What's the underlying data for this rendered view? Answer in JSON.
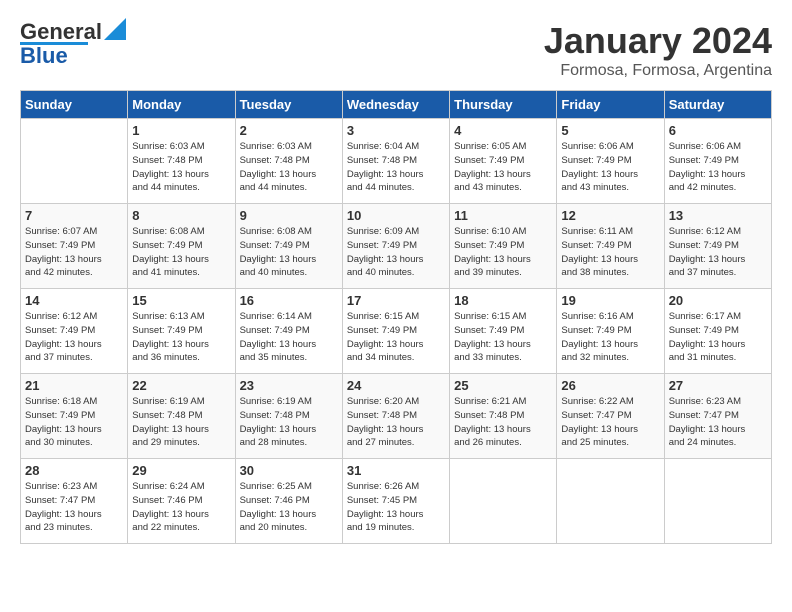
{
  "logo": {
    "general": "General",
    "blue": "Blue"
  },
  "header": {
    "month_year": "January 2024",
    "location": "Formosa, Formosa, Argentina"
  },
  "days_of_week": [
    "Sunday",
    "Monday",
    "Tuesday",
    "Wednesday",
    "Thursday",
    "Friday",
    "Saturday"
  ],
  "weeks": [
    [
      {
        "day": "",
        "sunrise": "",
        "sunset": "",
        "daylight": ""
      },
      {
        "day": "1",
        "sunrise": "6:03 AM",
        "sunset": "7:48 PM",
        "daylight": "13 hours and 44 minutes."
      },
      {
        "day": "2",
        "sunrise": "6:03 AM",
        "sunset": "7:48 PM",
        "daylight": "13 hours and 44 minutes."
      },
      {
        "day": "3",
        "sunrise": "6:04 AM",
        "sunset": "7:48 PM",
        "daylight": "13 hours and 44 minutes."
      },
      {
        "day": "4",
        "sunrise": "6:05 AM",
        "sunset": "7:49 PM",
        "daylight": "13 hours and 43 minutes."
      },
      {
        "day": "5",
        "sunrise": "6:06 AM",
        "sunset": "7:49 PM",
        "daylight": "13 hours and 43 minutes."
      },
      {
        "day": "6",
        "sunrise": "6:06 AM",
        "sunset": "7:49 PM",
        "daylight": "13 hours and 42 minutes."
      }
    ],
    [
      {
        "day": "7",
        "sunrise": "6:07 AM",
        "sunset": "7:49 PM",
        "daylight": "13 hours and 42 minutes."
      },
      {
        "day": "8",
        "sunrise": "6:08 AM",
        "sunset": "7:49 PM",
        "daylight": "13 hours and 41 minutes."
      },
      {
        "day": "9",
        "sunrise": "6:08 AM",
        "sunset": "7:49 PM",
        "daylight": "13 hours and 40 minutes."
      },
      {
        "day": "10",
        "sunrise": "6:09 AM",
        "sunset": "7:49 PM",
        "daylight": "13 hours and 40 minutes."
      },
      {
        "day": "11",
        "sunrise": "6:10 AM",
        "sunset": "7:49 PM",
        "daylight": "13 hours and 39 minutes."
      },
      {
        "day": "12",
        "sunrise": "6:11 AM",
        "sunset": "7:49 PM",
        "daylight": "13 hours and 38 minutes."
      },
      {
        "day": "13",
        "sunrise": "6:12 AM",
        "sunset": "7:49 PM",
        "daylight": "13 hours and 37 minutes."
      }
    ],
    [
      {
        "day": "14",
        "sunrise": "6:12 AM",
        "sunset": "7:49 PM",
        "daylight": "13 hours and 37 minutes."
      },
      {
        "day": "15",
        "sunrise": "6:13 AM",
        "sunset": "7:49 PM",
        "daylight": "13 hours and 36 minutes."
      },
      {
        "day": "16",
        "sunrise": "6:14 AM",
        "sunset": "7:49 PM",
        "daylight": "13 hours and 35 minutes."
      },
      {
        "day": "17",
        "sunrise": "6:15 AM",
        "sunset": "7:49 PM",
        "daylight": "13 hours and 34 minutes."
      },
      {
        "day": "18",
        "sunrise": "6:15 AM",
        "sunset": "7:49 PM",
        "daylight": "13 hours and 33 minutes."
      },
      {
        "day": "19",
        "sunrise": "6:16 AM",
        "sunset": "7:49 PM",
        "daylight": "13 hours and 32 minutes."
      },
      {
        "day": "20",
        "sunrise": "6:17 AM",
        "sunset": "7:49 PM",
        "daylight": "13 hours and 31 minutes."
      }
    ],
    [
      {
        "day": "21",
        "sunrise": "6:18 AM",
        "sunset": "7:49 PM",
        "daylight": "13 hours and 30 minutes."
      },
      {
        "day": "22",
        "sunrise": "6:19 AM",
        "sunset": "7:48 PM",
        "daylight": "13 hours and 29 minutes."
      },
      {
        "day": "23",
        "sunrise": "6:19 AM",
        "sunset": "7:48 PM",
        "daylight": "13 hours and 28 minutes."
      },
      {
        "day": "24",
        "sunrise": "6:20 AM",
        "sunset": "7:48 PM",
        "daylight": "13 hours and 27 minutes."
      },
      {
        "day": "25",
        "sunrise": "6:21 AM",
        "sunset": "7:48 PM",
        "daylight": "13 hours and 26 minutes."
      },
      {
        "day": "26",
        "sunrise": "6:22 AM",
        "sunset": "7:47 PM",
        "daylight": "13 hours and 25 minutes."
      },
      {
        "day": "27",
        "sunrise": "6:23 AM",
        "sunset": "7:47 PM",
        "daylight": "13 hours and 24 minutes."
      }
    ],
    [
      {
        "day": "28",
        "sunrise": "6:23 AM",
        "sunset": "7:47 PM",
        "daylight": "13 hours and 23 minutes."
      },
      {
        "day": "29",
        "sunrise": "6:24 AM",
        "sunset": "7:46 PM",
        "daylight": "13 hours and 22 minutes."
      },
      {
        "day": "30",
        "sunrise": "6:25 AM",
        "sunset": "7:46 PM",
        "daylight": "13 hours and 20 minutes."
      },
      {
        "day": "31",
        "sunrise": "6:26 AM",
        "sunset": "7:45 PM",
        "daylight": "13 hours and 19 minutes."
      },
      {
        "day": "",
        "sunrise": "",
        "sunset": "",
        "daylight": ""
      },
      {
        "day": "",
        "sunrise": "",
        "sunset": "",
        "daylight": ""
      },
      {
        "day": "",
        "sunrise": "",
        "sunset": "",
        "daylight": ""
      }
    ]
  ],
  "labels": {
    "sunrise": "Sunrise:",
    "sunset": "Sunset:",
    "daylight": "Daylight:"
  }
}
